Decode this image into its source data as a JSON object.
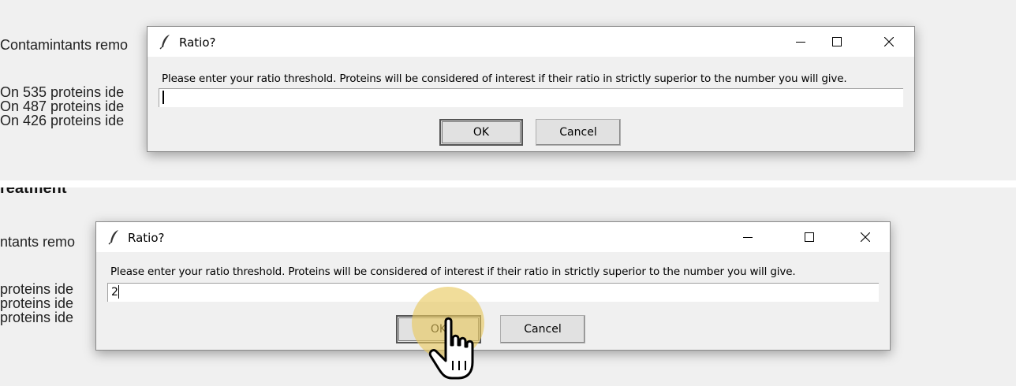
{
  "top_panel": {
    "background_lines": [
      "Contamintants remo",
      "On 535 proteins ide",
      "On 487 proteins ide",
      "On 426 proteins ide"
    ],
    "dialog": {
      "title": "Ratio?",
      "prompt": "Please enter your ratio threshold. Proteins will be considered of interest if their ratio in strictly superior to the number you will give.",
      "input_value": "",
      "ok_label": "OK",
      "cancel_label": "Cancel"
    }
  },
  "bottom_panel": {
    "heading_fragment": "reatment",
    "background_lines": [
      "ntants remo",
      "proteins ide",
      "proteins ide",
      "proteins ide"
    ],
    "dialog": {
      "title": "Ratio?",
      "prompt": "Please enter your ratio threshold. Proteins will be considered of interest if their ratio in strictly superior to the number you will give.",
      "input_value": "2",
      "ok_label": "OK",
      "cancel_label": "Cancel"
    },
    "click_highlight_color": "#e8c85c",
    "cursor": "hand-pointer-icon"
  },
  "icons": {
    "app": "feather-icon",
    "minimize": "minimize-icon",
    "maximize": "maximize-icon",
    "close": "close-icon"
  }
}
